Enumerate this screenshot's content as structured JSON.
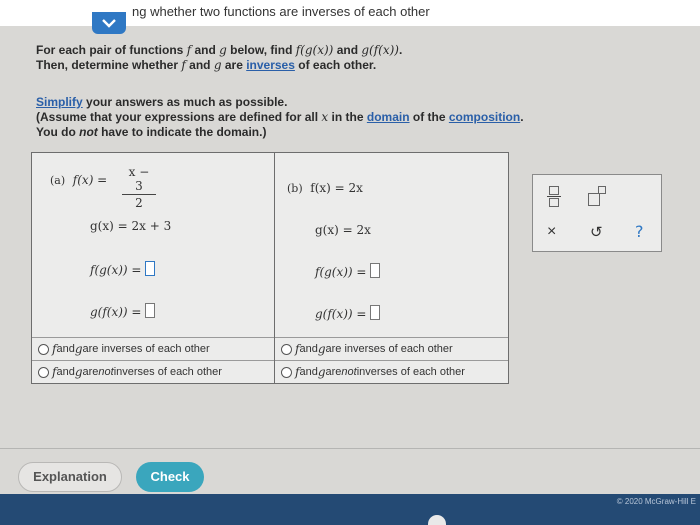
{
  "header": {
    "title": "ng whether two functions are inverses of each other"
  },
  "instructions": {
    "line1_prefix": "For each pair of functions ",
    "f": "f",
    "and": " and ",
    "g": "g",
    "line1_mid": " below, find ",
    "fgx": "f(g(x))",
    "gfx": "g(f(x))",
    "period": ".",
    "line2_prefix": "Then, determine whether ",
    "line2_and": " and ",
    "line2_are": " are ",
    "inverses_link": "inverses",
    "line2_suffix": " of each other.",
    "simplify_link": "Simplify",
    "line3_suffix": " your answers as much as possible.",
    "line4_prefix": "(Assume that your expressions are defined for all ",
    "x": "x",
    "line4_mid": " in the ",
    "domain_link": "domain",
    "line4_mid2": " of the ",
    "composition_link": "composition",
    "line4_suffix": ".",
    "line5_prefix": "You do ",
    "not": "not",
    "line5_suffix": " have to indicate the domain.)"
  },
  "problems": {
    "a": {
      "label": "(a)",
      "f_lhs": "f(x) =",
      "f_num": "x − 3",
      "f_den": "2",
      "g_expr": "g(x) = 2x + 3",
      "fg_lhs": "f(g(x)) =",
      "gf_lhs": "g(f(x)) =",
      "option1_mid": " and ",
      "option1_suffix": " are inverses of each other",
      "option2_mid": " and ",
      "option2_suffix": " are ",
      "option2_not": "not",
      "option2_end": " inverses of each other",
      "f": "f",
      "g": "g"
    },
    "b": {
      "label": "(b)",
      "f_expr": "f(x) = 2x",
      "g_expr": "g(x) = 2x",
      "fg_lhs": "f(g(x)) =",
      "gf_lhs": "g(f(x)) =",
      "option1_mid": " and ",
      "option1_suffix": " are inverses of each other",
      "option2_mid": " and ",
      "option2_suffix": " are ",
      "option2_not": "not",
      "option2_end": " inverses of each other",
      "f": "f",
      "g": "g"
    }
  },
  "palette": {
    "clear_symbol": "×",
    "undo_symbol": "↺",
    "help_symbol": "?"
  },
  "footer": {
    "explanation_label": "Explanation",
    "check_label": "Check",
    "copyright": "© 2020 McGraw-Hill E"
  },
  "colors": {
    "accent_blue": "#2f78c4",
    "check_button": "#3aa6bd",
    "bottom_bar": "#244a74",
    "link": "#2a5fa8"
  },
  "icons": [
    "chevron-down-icon",
    "fraction-icon",
    "exponent-icon",
    "clear-icon",
    "undo-icon",
    "help-icon"
  ]
}
